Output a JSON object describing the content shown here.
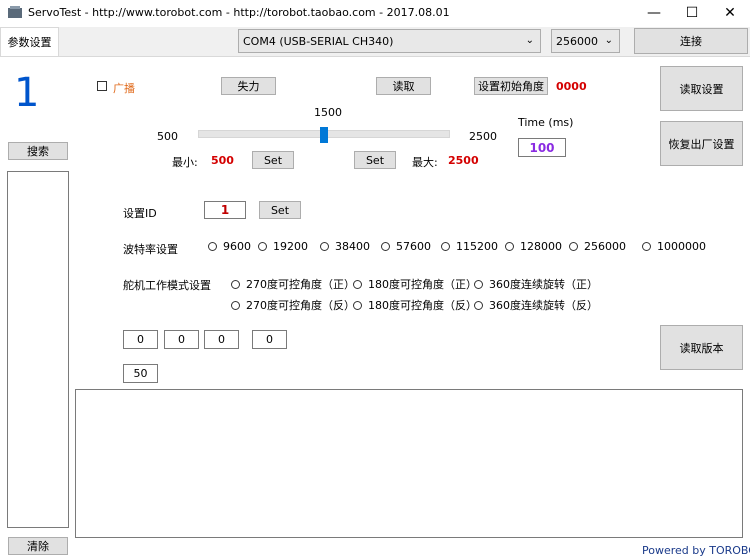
{
  "window": {
    "title": "ServoTest  -  http://www.torobot.com  -  http://torobot.taobao.com  -  2017.08.01",
    "min_glyph": "—",
    "max_glyph": "☐",
    "close_glyph": "✕"
  },
  "tabs": [
    {
      "label": "参数设置"
    }
  ],
  "port_combo": {
    "value": "COM4 (USB-SERIAL CH340)"
  },
  "baud_combo": {
    "value": "256000"
  },
  "connect_button": "连接",
  "servo_id_display": "1",
  "search_button": "搜索",
  "clear_button": "清除",
  "broadcast_label": "广播",
  "lose_power_button": "失力",
  "read_button": "读取",
  "set_init_angle_button": "设置初始角度",
  "init_angle_value": "0000",
  "read_settings_button": "读取设置",
  "restore_factory_button": "恢复出厂设置",
  "read_version_button": "读取版本",
  "slider": {
    "min_label": "500",
    "max_label": "2500",
    "current_label": "1500",
    "min": 500,
    "max": 2500,
    "value": 1500
  },
  "min_row": {
    "label": "最小:",
    "value": "500",
    "set": "Set"
  },
  "max_row": {
    "label": "最大:",
    "value": "2500",
    "set": "Set"
  },
  "time": {
    "label": "Time (ms)",
    "value": "100"
  },
  "set_id": {
    "label": "设置ID",
    "value": "1",
    "set": "Set"
  },
  "baud_setting": {
    "label": "波特率设置",
    "options": [
      "9600",
      "19200",
      "38400",
      "57600",
      "115200",
      "128000",
      "256000",
      "1000000"
    ]
  },
  "mode_setting": {
    "label": "舵机工作模式设置",
    "options": [
      "270度可控角度（正）",
      "180度可控角度（正）",
      "360度连续旋转（正）",
      "270度可控角度（反）",
      "180度可控角度（反）",
      "360度连续旋转（反）"
    ]
  },
  "number_fields": [
    "0",
    "0",
    "0",
    "0"
  ],
  "number_field_extra": "50",
  "footer": "Powered by TOROBOT",
  "colors": {
    "accent": "#0055cc",
    "red_value": "#d40000",
    "purple": "#8a2be2"
  }
}
